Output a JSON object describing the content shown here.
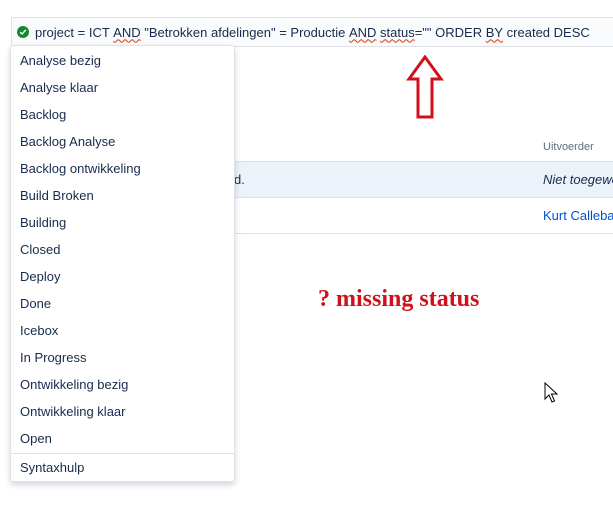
{
  "query_bar": {
    "status_icon": "check-circle-icon",
    "status_color": "#14892c",
    "parts": [
      {
        "text": "project = ICT ",
        "squiggle": false
      },
      {
        "text": "AND",
        "squiggle": true
      },
      {
        "text": " \"Betrokken afdelingen\" = Productie ",
        "squiggle": false
      },
      {
        "text": "AND",
        "squiggle": true
      },
      {
        "text": " ",
        "squiggle": false
      },
      {
        "text": "status",
        "squiggle": true
      },
      {
        "text": "=\"\" ORDER ",
        "squiggle": false
      },
      {
        "text": "BY",
        "squiggle": true
      },
      {
        "text": " created DESC",
        "squiggle": false
      }
    ]
  },
  "dropdown": {
    "items": [
      "Analyse bezig",
      "Analyse klaar",
      "Backlog",
      "Backlog Analyse",
      "Backlog ontwikkeling",
      "Build Broken",
      "Building",
      "Closed",
      "Deploy",
      "Done",
      "Icebox",
      "In Progress",
      "Ontwikkeling bezig",
      "Ontwikkeling klaar",
      "Open"
    ],
    "footer": "Syntaxhulp"
  },
  "results": {
    "column_header": "Uitvoerder",
    "rows": [
      {
        "fragment": "d.",
        "assignee": "Niet toegewe",
        "unassigned": true
      },
      {
        "fragment": "",
        "assignee": "Kurt Callebau",
        "unassigned": false
      }
    ]
  },
  "annotation": {
    "text": "? missing status",
    "color": "#d0111b",
    "arrow": "up-arrow-outline-icon"
  }
}
